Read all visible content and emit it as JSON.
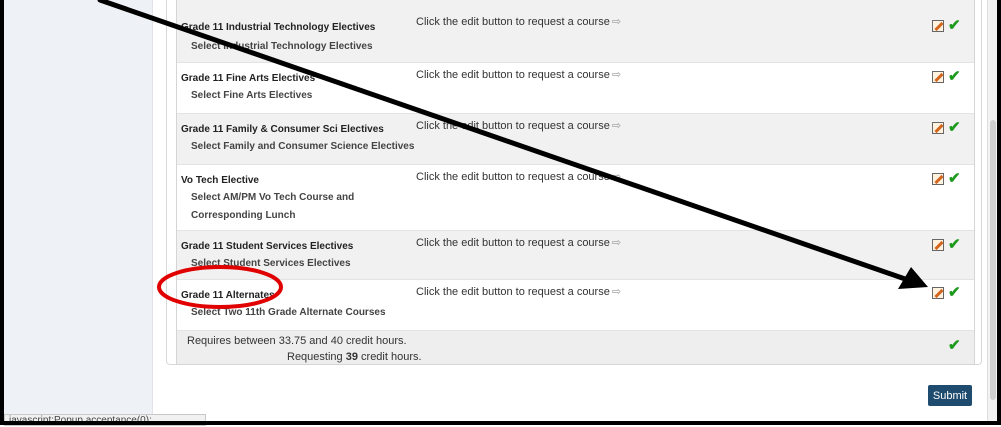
{
  "rows": [
    {
      "title": "Grade 11 Industrial Technology Electives",
      "sub": "Select Industrial Technology Electives",
      "message": "Click the edit button to request a course"
    },
    {
      "title": "Grade 11 Fine Arts Electives",
      "sub": "Select Fine Arts Electives",
      "message": "Click the edit button to request a course"
    },
    {
      "title": "Grade 11 Family & Consumer Sci Electives",
      "sub": "Select Family and Consumer Science Electives",
      "message": "Click the edit button to request a course"
    },
    {
      "title": "Vo Tech Elective",
      "sub": "Select AM/PM Vo Tech Course and Corresponding Lunch",
      "message": "Click the edit button to request a course"
    },
    {
      "title": "Grade 11 Student Services Electives",
      "sub": "Select Student Services Electives",
      "message": "Click the edit button to request a course"
    },
    {
      "title": "Grade 11 Alternates",
      "sub": "Select Two 11th Grade Alternate Courses",
      "message": "Click the edit button to request a course"
    }
  ],
  "summary": {
    "line1": "Requires between 33.75 and 40 credit hours.",
    "line2_prefix": "Requesting ",
    "line2_value": "39",
    "line2_suffix": " credit hours."
  },
  "submit_label": "Submit",
  "status_url": "javascript:Popup.acceptance(0);",
  "arrow_glyph": "⇨",
  "check_glyph": "✔",
  "icons": {
    "edit": "edit-pencil-icon",
    "check": "green-check-icon"
  },
  "colors": {
    "submit_bg": "#1f4b6e",
    "check": "#1f9a1f",
    "annotation": "#e00000"
  }
}
